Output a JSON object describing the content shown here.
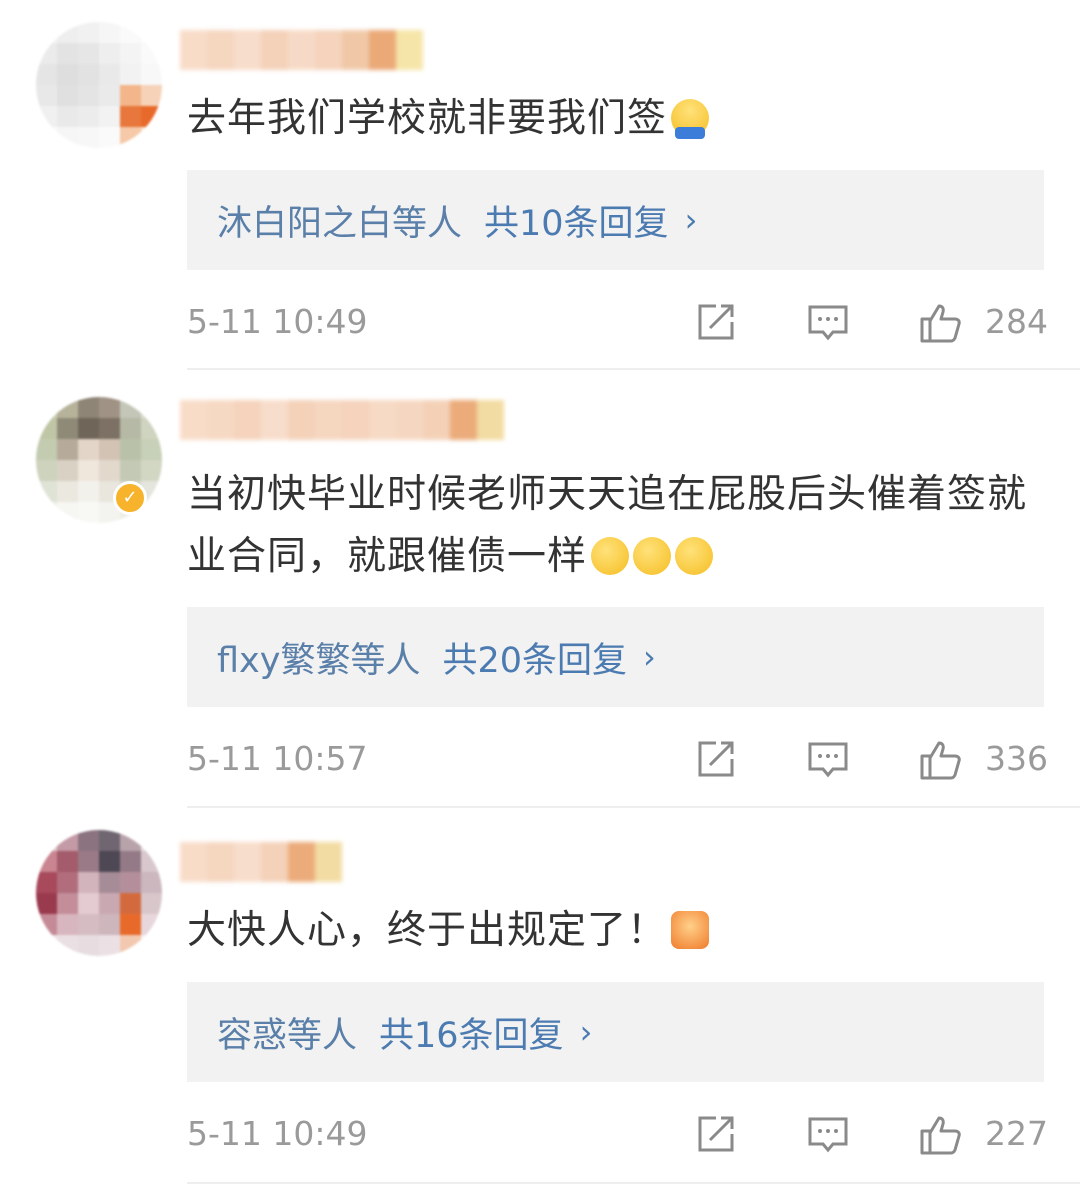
{
  "comments": [
    {
      "text": "去年我们学校就非要我们签",
      "emoji": "shrug-emoji",
      "reply_names": "沐白阳之白等人",
      "reply_count": "共10条回复",
      "time": "5-11 10:49",
      "likes": "284"
    },
    {
      "text": "当初快毕业时候老师天天追在屁股后头催着签就业合同，就跟催债一样",
      "emoji": "dizzy-face-emoji",
      "reply_names": "flxy繁繁等人",
      "reply_count": "共20条回复",
      "time": "5-11 10:57",
      "likes": "336"
    },
    {
      "text": "大快人心，终于出规定了！",
      "emoji": "clapping-hands-emoji",
      "reply_names": "容惑等人",
      "reply_count": "共16条回复",
      "time": "5-11 10:49",
      "likes": "227"
    }
  ],
  "arrow": "›",
  "colors": {
    "link": "#4b7bb0",
    "meta_text": "#9a9a9a",
    "reply_bg": "#f2f2f2"
  }
}
